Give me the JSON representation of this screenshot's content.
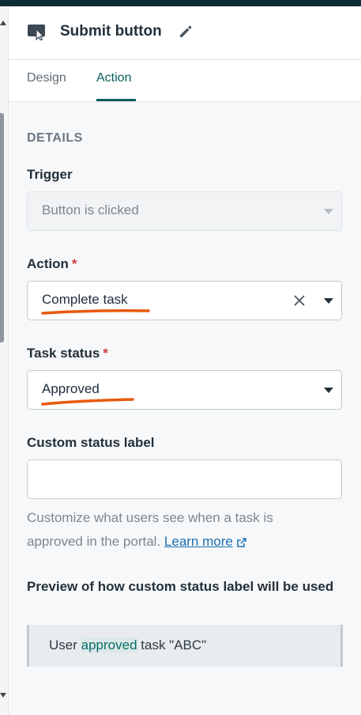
{
  "header": {
    "title": "Submit button",
    "component_icon": "cursor-button-icon",
    "edit_icon": "pencil-icon"
  },
  "tabs": [
    {
      "label": "Design",
      "active": false
    },
    {
      "label": "Action",
      "active": true
    }
  ],
  "section_title": "DETAILS",
  "trigger": {
    "label": "Trigger",
    "value": "Button is clicked",
    "disabled": true
  },
  "action": {
    "label": "Action",
    "required_marker": "*",
    "value": "Complete task"
  },
  "task_status": {
    "label": "Task status",
    "required_marker": "*",
    "value": "Approved"
  },
  "custom_status": {
    "label": "Custom status label",
    "value": "",
    "helper_text": "Customize what users see when a task is approved in the portal.",
    "learn_more": "Learn more"
  },
  "preview": {
    "label": "Preview of how custom status label will be used",
    "prefix": "User",
    "highlight": "approved",
    "suffix": "task \"ABC\""
  },
  "colors": {
    "accent": "#0b5f5c",
    "required": "#d33c3c",
    "annotation": "#e8590c",
    "link": "#1c6fb0"
  }
}
